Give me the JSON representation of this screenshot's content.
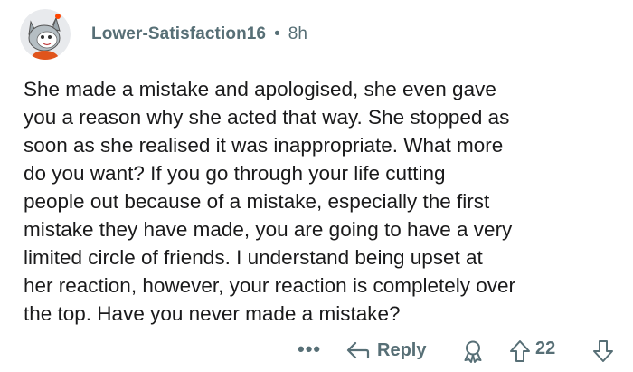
{
  "comment": {
    "username": "Lower-Satisfaction16",
    "separator": "•",
    "time": "8h",
    "body_lines": [
      "She made a mistake and apologised, she even gave",
      "you a reason why she acted that way. She stopped as",
      "soon as she realised it was inappropriate. What more",
      "do you want?  If you go through your life cutting",
      "people out because of a mistake, especially the first",
      "mistake they have made, you are going to have a very",
      "limited circle of friends. I understand being upset at",
      "her reaction, however, your reaction is completely over",
      "the top. Have you never made a mistake?"
    ]
  },
  "actions": {
    "more_label": "•••",
    "reply_label": "Reply",
    "score": "22",
    "icons": {
      "reply": "reply-arrow-icon",
      "award": "award-icon",
      "upvote": "upvote-arrow-icon",
      "downvote": "downvote-arrow-icon",
      "more": "more-options-icon"
    }
  },
  "colors": {
    "text": "#1a1a1b",
    "meta": "#576f76",
    "background": "#ffffff"
  }
}
